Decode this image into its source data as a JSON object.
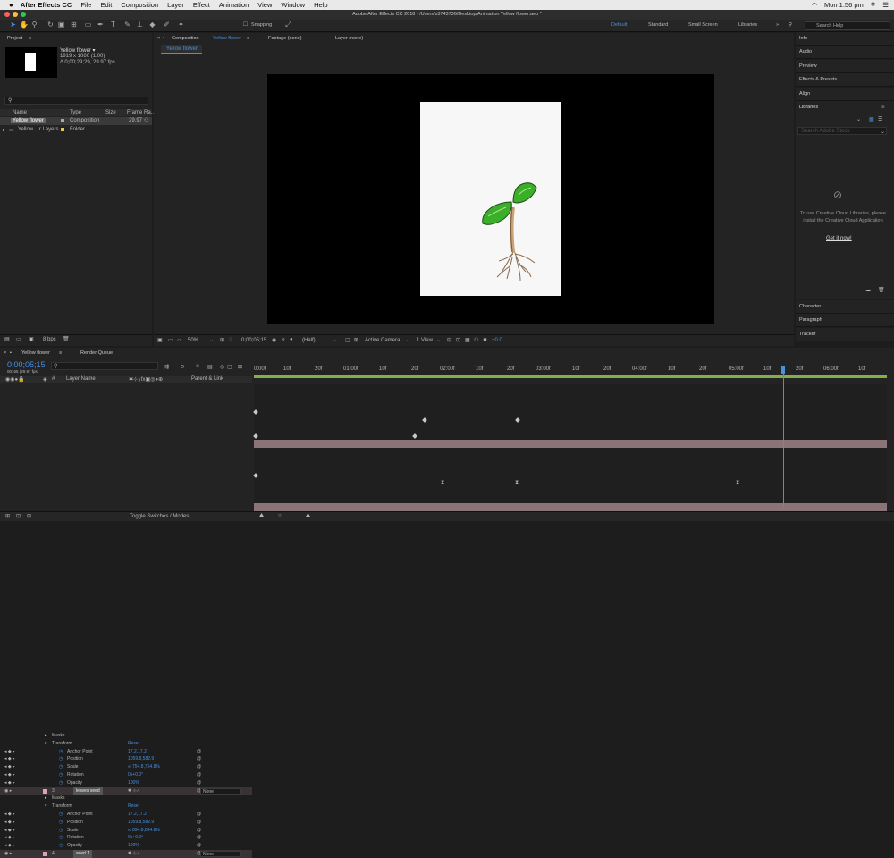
{
  "menubar": {
    "app": "After Effects CC",
    "items": [
      "File",
      "Edit",
      "Composition",
      "Layer",
      "Effect",
      "Animation",
      "View",
      "Window",
      "Help"
    ],
    "clock": "Mon 1:56 pm"
  },
  "window": {
    "title": "Adobe After Effects CC 2018 - /Users/s3743736/Desktop/Animation Yellow flower.aep *"
  },
  "toolbar": {
    "snapping": "Snapping",
    "workspaces": [
      "Default",
      "Standard",
      "Small Screen",
      "Libraries"
    ],
    "search_placeholder": "Search Help"
  },
  "project": {
    "tab": "Project",
    "comp_name": "Yellow flower ▾",
    "comp_size": "1919 x 1080 (1.00)",
    "comp_duration": "Δ 0;00;29;29, 29.97 fps",
    "search_placeholder": "",
    "columns": [
      "Name",
      "Type",
      "Size",
      "Frame Ra..."
    ],
    "items": [
      {
        "name": "Yellow flower",
        "type": "Composition",
        "fps": "29.97"
      },
      {
        "name": "Yellow ...r Layers",
        "type": "Folder",
        "fps": ""
      }
    ],
    "bpc": "8 bpc"
  },
  "viewer": {
    "comp_tab_prefix": "Composition",
    "comp_tab_name": "Yellow flower",
    "footage_tab": "Footage (none)",
    "layer_tab": "Layer (none)",
    "breadcrumb": "Yellow flower",
    "zoom": "50%",
    "timecode": "0;00;05;15",
    "resolution": "(Half)",
    "camera": "Active Camera",
    "views": "1 View",
    "exposure": "+0.0"
  },
  "right_panel": {
    "items": [
      "Info",
      "Audio",
      "Preview",
      "Effects & Presets",
      "Align",
      "Libraries"
    ],
    "search_placeholder": "Search Adobe Stock",
    "message": "To use Creative Cloud Libraries, please install the Creative Cloud Application",
    "link": "Get it now!",
    "bottom_items": [
      "Character",
      "Paragraph",
      "Tracker"
    ]
  },
  "timeline": {
    "tab": "Yellow flower",
    "render_queue": "Render Queue",
    "timecode": "0;00;05;15",
    "fps_info": "00165 (29.97 fps)",
    "col_layer_name": "Layer Name",
    "col_parent": "Parent & Link",
    "toggle": "Toggle Switches / Modes",
    "ruler": [
      "0:00f",
      "10f",
      "20f",
      "01:00f",
      "10f",
      "20f",
      "02:00f",
      "10f",
      "20f",
      "03:00f",
      "10f",
      "20f",
      "04:00f",
      "10f",
      "20f",
      "05:00f",
      "10f",
      "20f",
      "06:00f",
      "10f"
    ],
    "rows": [
      {
        "indent": 1,
        "name": "Masks",
        "value": ""
      },
      {
        "indent": 1,
        "name": "Transform",
        "value": "Reset"
      },
      {
        "indent": 2,
        "name": "Anchor Point",
        "value": "17.2,17.2"
      },
      {
        "indent": 2,
        "name": "Position",
        "value": "1059.8,582.9"
      },
      {
        "indent": 2,
        "name": "Scale",
        "value": "∞ 754.8,754.8%"
      },
      {
        "indent": 2,
        "name": "Rotation",
        "value": "0x+0.0°"
      },
      {
        "indent": 2,
        "name": "Opacity",
        "value": "100%"
      },
      {
        "indent": 0,
        "num": "3",
        "name": "leaves seed",
        "value": "",
        "parent": "None"
      },
      {
        "indent": 1,
        "name": "Masks",
        "value": ""
      },
      {
        "indent": 1,
        "name": "Transform",
        "value": "Reset"
      },
      {
        "indent": 2,
        "name": "Anchor Point",
        "value": "17.2,17.2"
      },
      {
        "indent": 2,
        "name": "Position",
        "value": "1059.8,582.9"
      },
      {
        "indent": 2,
        "name": "Scale",
        "value": "∞ 894.8,894.8%"
      },
      {
        "indent": 2,
        "name": "Rotation",
        "value": "0x+0.0°"
      },
      {
        "indent": 2,
        "name": "Opacity",
        "value": "100%"
      },
      {
        "indent": 0,
        "num": "4",
        "name": "seed 1",
        "value": "",
        "parent": "None"
      }
    ]
  }
}
